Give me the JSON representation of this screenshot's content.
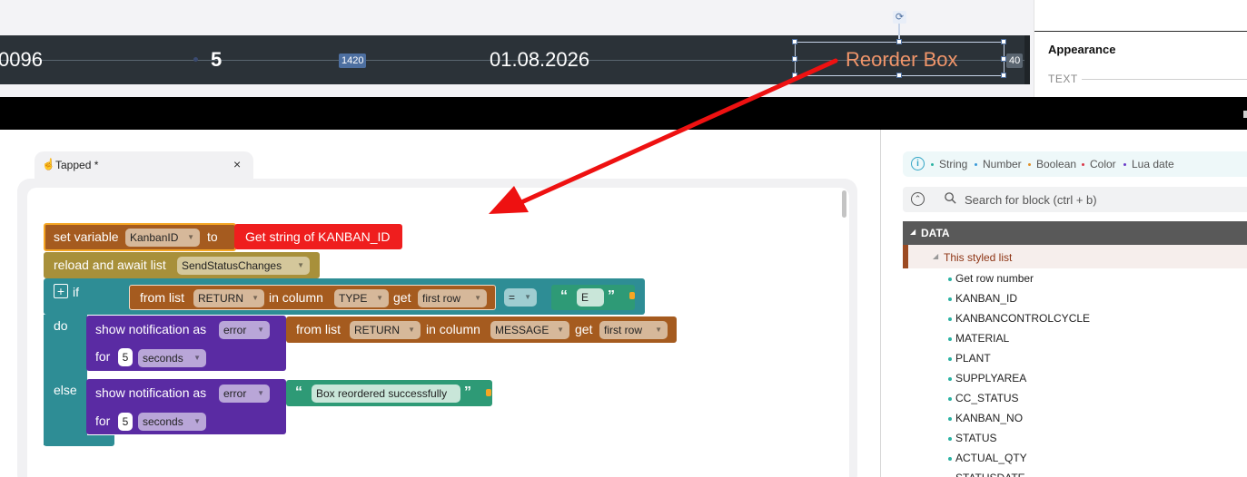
{
  "canvas": {
    "row_number": "0096",
    "row_bold": "5",
    "measure_width": "1420",
    "row_date": "01.08.2026",
    "selected_label": "Reorder Box",
    "measure_side": "40"
  },
  "appearance": {
    "title": "Appearance",
    "text_section": "TEXT"
  },
  "editor": {
    "tab_label": "Tapped *",
    "tab_close": "×",
    "blocks": {
      "set_variable": "set variable",
      "var_name": "KanbanID",
      "to": "to",
      "get_string": "Get string of KANBAN_ID",
      "reload": "reload and await list",
      "reload_list": "SendStatusChanges",
      "if": "if",
      "from_list": "from list",
      "return_list": "RETURN",
      "in_column": "in column",
      "type_col": "TYPE",
      "get": "get",
      "first_row": "first row",
      "eq": "=",
      "str_e": "E",
      "do": "do",
      "show_notification": "show notification as",
      "error": "error",
      "message_col": "MESSAGE",
      "for": "for",
      "five": "5",
      "seconds": "seconds",
      "else": "else",
      "success_text": "Box reordered successfully"
    }
  },
  "toolbox": {
    "legend": [
      {
        "label": "String",
        "color": "#2bb3a3"
      },
      {
        "label": "Number",
        "color": "#3a9ad9"
      },
      {
        "label": "Boolean",
        "color": "#e0902a"
      },
      {
        "label": "Color",
        "color": "#d9394a"
      },
      {
        "label": "Lua date",
        "color": "#6a3cc9"
      }
    ],
    "search_placeholder": "Search for block (ctrl + b)",
    "data_header": "DATA",
    "styled_list": "This styled list",
    "fields": [
      "Get row number",
      "KANBAN_ID",
      "KANBANCONTROLCYCLE",
      "MATERIAL",
      "PLANT",
      "SUPPLYAREA",
      "CC_STATUS",
      "KANBAN_NO",
      "STATUS",
      "ACTUAL_QTY",
      "STATUSDATE"
    ]
  },
  "colors": {
    "variable_block": "#a55b1f",
    "list_block": "#a8903a",
    "logic_block": "#2e8d95",
    "notification_block": "#5a2ba3",
    "string_block": "#2e9a76",
    "get_string_block": "#ef1e1e",
    "arrow": "#ee1111"
  }
}
